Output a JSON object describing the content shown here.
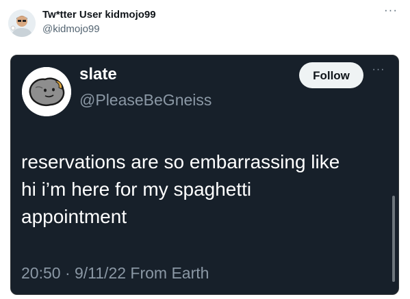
{
  "outer": {
    "display_name": "Tw*tter User kidmojo99",
    "handle": "@kidmojo99",
    "more_label": "···"
  },
  "tweet": {
    "display_name": "slate",
    "handle": "@PleaseBeGneiss",
    "follow_label": "Follow",
    "more_label": "···",
    "text_lines": [
      "reservations are so embarrassing like",
      "hi i’m here for my spaghetti",
      "appointment"
    ],
    "meta": "20:50 · 9/11/22 From Earth"
  },
  "icons": {
    "outer_avatar": "user-avatar-icon",
    "inner_avatar": "rock-avatar-icon"
  },
  "colors": {
    "card_bg": "#17202a",
    "follow_bg": "#eff3f4",
    "secondary_text": "#8b98a5"
  }
}
